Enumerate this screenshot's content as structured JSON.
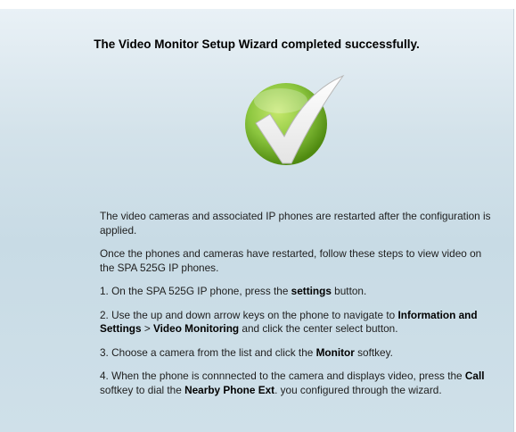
{
  "wizard": {
    "title": "The Video Monitor Setup Wizard completed successfully.",
    "success_icon": "green-checkmark-icon",
    "paragraphs": {
      "p1": "The video cameras and associated IP phones are restarted after the configuration is applied.",
      "p2": "Once the phones and cameras have restarted, follow these steps to view video on the SPA 525G IP phones."
    },
    "steps": {
      "s1": {
        "prefix": "1. On the SPA 525G IP phone, press the ",
        "bold": "settings",
        "suffix": " button."
      },
      "s2": {
        "prefix": "2. Use the up and down arrow keys on the phone to navigate to ",
        "bold1": "Information and Settings",
        "mid": " > ",
        "bold2": "Video Monitoring",
        "suffix": " and click the center select button."
      },
      "s3": {
        "prefix": "3. Choose a camera from the list and click the ",
        "bold": "Monitor",
        "suffix": " softkey."
      },
      "s4": {
        "prefix": "4. When the phone is connnected to the camera and displays video, press the ",
        "bold1": "Call",
        "mid": " softkey to dial the ",
        "bold2": "Nearby Phone Ext",
        "suffix": ". you configured through the wizard."
      }
    },
    "colors": {
      "check_green": "#8cc63f",
      "check_dark_green": "#4f8a10",
      "background": "#d3e2ea"
    }
  }
}
